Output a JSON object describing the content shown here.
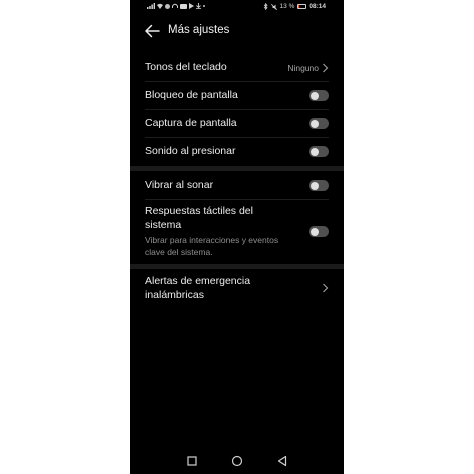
{
  "status_bar": {
    "battery_text": "13 %",
    "battery_level": 0.13,
    "time": "08:14",
    "left_icons": [
      "signal-icon",
      "wifi-icon",
      "whatsapp-icon",
      "headphones-icon",
      "youtube-icon",
      "play-icon",
      "download-icon",
      "dot-icon"
    ],
    "right_icons": [
      "bluetooth-icon",
      "mute-icon",
      "battery-icon"
    ]
  },
  "header": {
    "title": "Más ajustes",
    "back_icon": "arrow-left-icon"
  },
  "items": [
    {
      "label": "Tonos del teclado",
      "value": "Ninguno",
      "control": "chevron"
    },
    {
      "label": "Bloqueo de pantalla",
      "control": "toggle",
      "checked": false
    },
    {
      "label": "Captura de pantalla",
      "control": "toggle",
      "checked": false
    },
    {
      "label": "Sonido al presionar",
      "control": "toggle",
      "checked": false
    },
    {
      "label": "Vibrar al sonar",
      "control": "toggle",
      "checked": false
    },
    {
      "label_line1": "Respuestas táctiles del",
      "label_line2": "sistema",
      "description_line1": "Vibrar para interacciones y eventos",
      "description_line2": "clave del sistema.",
      "control": "toggle",
      "checked": false
    },
    {
      "label_line1": "Alertas de emergencia",
      "label_line2": "inalámbricas",
      "control": "chevron"
    }
  ],
  "nav_bar": {
    "buttons": [
      "recents-square-icon",
      "home-circle-icon",
      "back-triangle-icon"
    ]
  },
  "colors": {
    "background": "#000000",
    "text": "#ededed",
    "secondary_text": "#8f8f8f",
    "toggle_off": "#505050",
    "battery_low": "#e4572e"
  }
}
